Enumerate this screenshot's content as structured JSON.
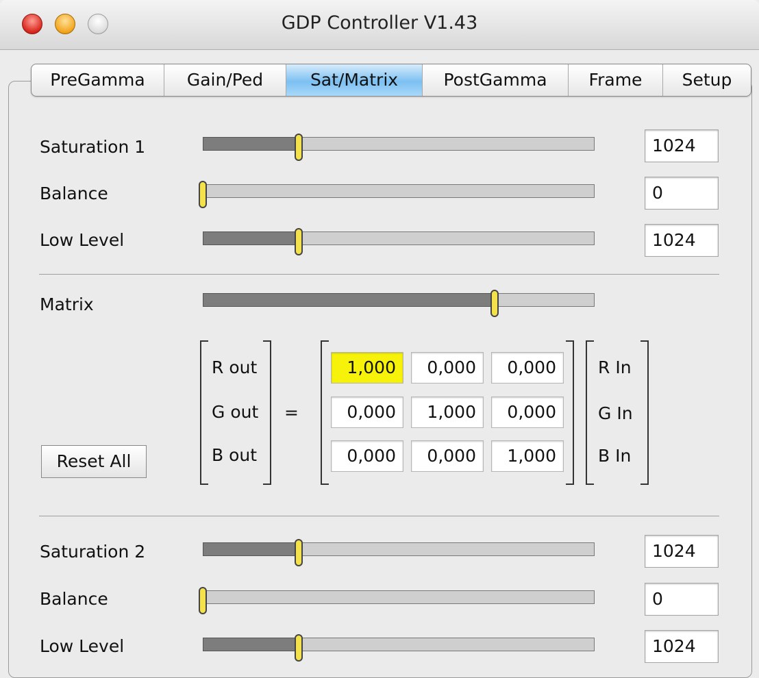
{
  "window": {
    "title": "GDP Controller V1.43"
  },
  "tabs": [
    {
      "label": "PreGamma",
      "active": false
    },
    {
      "label": "Gain/Ped",
      "active": false
    },
    {
      "label": "Sat/Matrix",
      "active": true
    },
    {
      "label": "PostGamma",
      "active": false
    },
    {
      "label": "Frame",
      "active": false
    },
    {
      "label": "Setup",
      "active": false
    }
  ],
  "top_sliders": [
    {
      "label": "Saturation 1",
      "value": "1024",
      "fraction": 0.245
    },
    {
      "label": "Balance",
      "value": "0",
      "fraction": 0.0
    },
    {
      "label": "Low Level",
      "value": "1024",
      "fraction": 0.245
    }
  ],
  "matrix": {
    "label": "Matrix",
    "slider_fraction": 0.745,
    "outputs": [
      "R out",
      "G out",
      "B out"
    ],
    "equals": "=",
    "inputs": [
      "R In",
      "G In",
      "B In"
    ],
    "cells": [
      [
        "1,000",
        "0,000",
        "0,000"
      ],
      [
        "0,000",
        "1,000",
        "0,000"
      ],
      [
        "0,000",
        "0,000",
        "1,000"
      ]
    ],
    "highlight_color": "#f6f20a"
  },
  "reset_button": {
    "label": "Reset All"
  },
  "bottom_sliders": [
    {
      "label": "Saturation 2",
      "value": "1024",
      "fraction": 0.245
    },
    {
      "label": "Balance",
      "value": "0",
      "fraction": 0.0
    },
    {
      "label": "Low Level",
      "value": "1024",
      "fraction": 0.245
    }
  ]
}
